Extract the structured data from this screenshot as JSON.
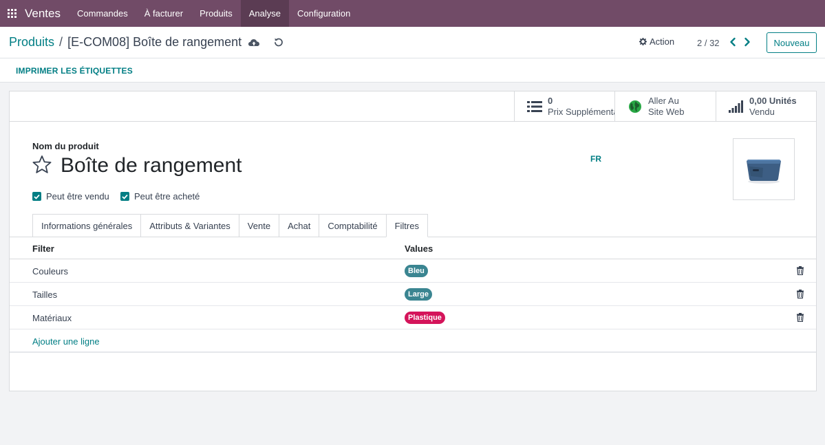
{
  "navbar": {
    "app_name": "Ventes",
    "menu": [
      {
        "label": "Commandes"
      },
      {
        "label": "À facturer"
      },
      {
        "label": "Produits"
      },
      {
        "label": "Analyse"
      },
      {
        "label": "Configuration"
      }
    ],
    "active_index": 3,
    "color": "#714b67"
  },
  "control_panel": {
    "breadcrumb_parent": "Produits",
    "breadcrumb_separator": "/",
    "breadcrumb_current": "[E-COM08] Boîte de rangement",
    "action_label": "Action",
    "pager": "2 / 32",
    "new_button": "Nouveau"
  },
  "action_row": {
    "print_labels": "IMPRIMER LES ÉTIQUETTES"
  },
  "smart_buttons": [
    {
      "value": "0",
      "label": "Prix Supplémenta",
      "icon": "list-icon"
    },
    {
      "value": "Aller Au",
      "label": "Site Web",
      "icon": "globe-icon"
    },
    {
      "value": "0,00 Unités",
      "label": "Vendu",
      "icon": "signal-bars-icon"
    }
  ],
  "product": {
    "field_label": "Nom du produit",
    "name": "Boîte de rangement",
    "lang": "FR",
    "can_be_sold": {
      "label": "Peut être vendu",
      "checked": true
    },
    "can_be_purchased": {
      "label": "Peut être acheté",
      "checked": true
    },
    "image_icon": "storage-box-image"
  },
  "tabs": [
    {
      "label": "Informations générales"
    },
    {
      "label": "Attributs & Variantes"
    },
    {
      "label": "Vente"
    },
    {
      "label": "Achat"
    },
    {
      "label": "Comptabilité"
    },
    {
      "label": "Filtres"
    }
  ],
  "active_tab": 5,
  "filters_table": {
    "headers": {
      "filter": "Filter",
      "values": "Values"
    },
    "rows": [
      {
        "filter": "Couleurs",
        "value": "Bleu",
        "tag_color": "#3a8591"
      },
      {
        "filter": "Tailles",
        "value": "Large",
        "tag_color": "#3a8591"
      },
      {
        "filter": "Matériaux",
        "value": "Plastique",
        "tag_color": "#d4145a"
      }
    ],
    "add_line": "Ajouter une ligne"
  },
  "colors": {
    "accent": "#017e84",
    "navbar": "#714b67",
    "navbar_active": "#5b3c53"
  }
}
